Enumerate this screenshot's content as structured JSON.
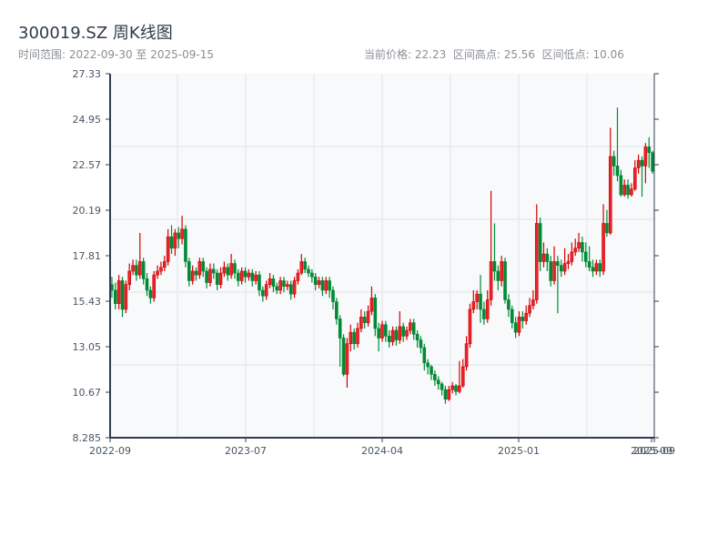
{
  "header": {
    "title": "300019.SZ 周K线图",
    "range_text": "时间范围: 2022-09-30 至 2025-09-15",
    "stats_text": "当前价格: 22.23  区间高点: 25.56  区间低点: 10.06"
  },
  "chart_data": {
    "type": "candlestick",
    "title": "300019.SZ 周K线图",
    "start_date": "2022-09-30",
    "end_date": "2025-09-15",
    "ylim": [
      8.285,
      27.33
    ],
    "y_ticks": [
      "27.33",
      "24.95",
      "22.57",
      "20.19",
      "17.81",
      "15.43",
      "13.05",
      "10.67",
      "8.285"
    ],
    "x_ticks": [
      "2022-09",
      "2023-07",
      "2024-04",
      "2025-01",
      "2025-09",
      "2025-09"
    ],
    "grid": true,
    "colors": {
      "up": "#d40000",
      "down": "#008a35"
    },
    "first_open": 16.3,
    "close": [
      16.0,
      15.3,
      16.5,
      15.0,
      16.3,
      17.0,
      17.3,
      16.8,
      17.5,
      16.6,
      16.0,
      15.6,
      16.8,
      17.0,
      17.2,
      17.5,
      18.8,
      18.2,
      19.0,
      18.7,
      19.2,
      17.5,
      16.5,
      17.0,
      16.8,
      17.5,
      17.0,
      16.4,
      17.1,
      16.9,
      16.3,
      16.9,
      17.2,
      16.8,
      17.4,
      16.9,
      16.5,
      17.0,
      16.7,
      16.9,
      16.5,
      16.8,
      16.0,
      15.7,
      16.3,
      16.6,
      16.2,
      16.0,
      16.5,
      16.2,
      16.3,
      15.8,
      16.5,
      16.9,
      17.5,
      17.1,
      16.9,
      16.7,
      16.3,
      16.5,
      16.0,
      16.5,
      16.0,
      15.4,
      14.5,
      13.5,
      11.6,
      13.2,
      13.8,
      13.2,
      14.0,
      14.6,
      14.3,
      14.9,
      15.6,
      14.0,
      13.5,
      14.2,
      13.6,
      13.3,
      13.9,
      13.4,
      14.1,
      13.6,
      13.9,
      14.3,
      13.7,
      13.4,
      13.0,
      12.2,
      12.0,
      11.6,
      11.3,
      11.1,
      10.8,
      10.3,
      10.8,
      11.0,
      10.7,
      11.0,
      12.0,
      13.2,
      15.0,
      15.4,
      15.8,
      15.0,
      14.5,
      15.5,
      17.5,
      17.0,
      16.5,
      17.5,
      15.5,
      15.0,
      14.3,
      13.8,
      14.6,
      14.4,
      14.8,
      15.2,
      15.5,
      19.5,
      17.5,
      17.9,
      17.5,
      16.5,
      17.5,
      17.3,
      17.0,
      17.4,
      17.5,
      18.0,
      18.2,
      18.5,
      18.0,
      17.5,
      17.2,
      17.0,
      17.4,
      17.0,
      19.5,
      19.0,
      23.0,
      22.5,
      22.0,
      21.0,
      21.5,
      21.0,
      21.3,
      22.4,
      22.8,
      22.5,
      23.5,
      23.2,
      22.23
    ],
    "high": [
      16.7,
      16.4,
      16.8,
      16.7,
      16.5,
      17.4,
      17.6,
      17.6,
      19.0,
      17.7,
      16.9,
      16.2,
      17.0,
      17.3,
      17.5,
      17.8,
      19.2,
      19.4,
      19.2,
      19.3,
      19.9,
      19.4,
      17.7,
      17.3,
      17.2,
      17.7,
      17.7,
      17.2,
      17.4,
      17.4,
      17.1,
      17.2,
      17.5,
      17.4,
      17.9,
      17.6,
      17.1,
      17.2,
      17.2,
      17.1,
      17.1,
      17.0,
      17.0,
      16.2,
      16.5,
      16.9,
      16.8,
      16.4,
      16.7,
      16.7,
      16.5,
      16.5,
      16.7,
      17.1,
      17.9,
      17.7,
      17.3,
      17.1,
      16.9,
      16.7,
      16.7,
      16.7,
      16.7,
      16.2,
      15.6,
      14.7,
      13.7,
      13.5,
      14.2,
      14.0,
      14.3,
      15.0,
      14.9,
      15.2,
      16.2,
      15.8,
      14.3,
      14.4,
      14.4,
      13.9,
      14.1,
      14.1,
      14.9,
      14.3,
      14.1,
      14.5,
      14.5,
      13.9,
      13.6,
      13.2,
      12.4,
      12.1,
      11.8,
      11.5,
      11.2,
      11.0,
      11.0,
      11.2,
      11.1,
      12.3,
      12.4,
      13.6,
      15.3,
      16.0,
      16.0,
      16.8,
      15.4,
      16.0,
      21.2,
      19.5,
      17.3,
      17.8,
      17.7,
      15.8,
      15.2,
      14.6,
      14.9,
      14.9,
      15.2,
      15.6,
      16.0,
      20.5,
      19.8,
      18.5,
      18.2,
      17.8,
      18.3,
      17.8,
      17.6,
      18.2,
      17.9,
      18.5,
      18.7,
      19.0,
      18.8,
      18.5,
      18.3,
      17.6,
      17.6,
      17.6,
      20.5,
      20.2,
      24.5,
      23.3,
      25.56,
      22.3,
      21.8,
      21.8,
      21.6,
      22.8,
      23.1,
      23.0,
      23.7,
      24.0,
      23.3
    ],
    "low": [
      15.6,
      15.0,
      15.0,
      14.6,
      14.8,
      16.0,
      16.8,
      16.5,
      16.6,
      16.3,
      15.7,
      15.3,
      15.4,
      16.6,
      16.8,
      17.0,
      17.3,
      17.9,
      17.8,
      18.2,
      18.4,
      17.2,
      16.2,
      16.3,
      16.5,
      16.6,
      16.7,
      16.1,
      16.2,
      16.6,
      16.0,
      16.1,
      16.7,
      16.5,
      16.6,
      16.6,
      16.2,
      16.3,
      16.4,
      16.5,
      16.2,
      16.3,
      15.7,
      15.4,
      15.5,
      16.1,
      15.9,
      15.8,
      15.8,
      15.9,
      16.0,
      15.5,
      15.6,
      16.3,
      16.8,
      16.9,
      16.7,
      16.4,
      16.0,
      16.1,
      15.7,
      15.8,
      15.6,
      15.0,
      14.2,
      12.0,
      11.5,
      10.9,
      12.8,
      12.9,
      13.0,
      13.8,
      14.0,
      14.1,
      14.7,
      13.6,
      12.8,
      13.3,
      13.3,
      13.0,
      13.1,
      13.1,
      13.2,
      13.3,
      13.4,
      13.7,
      13.4,
      13.0,
      12.7,
      11.8,
      11.6,
      11.3,
      11.0,
      10.8,
      10.5,
      10.06,
      10.2,
      10.6,
      10.5,
      10.6,
      10.9,
      11.8,
      13.0,
      14.8,
      15.0,
      14.3,
      14.2,
      14.3,
      15.2,
      16.5,
      16.0,
      16.2,
      15.3,
      14.6,
      14.0,
      13.5,
      13.6,
      14.0,
      14.2,
      14.6,
      15.0,
      15.3,
      17.0,
      17.2,
      17.0,
      16.2,
      16.3,
      14.8,
      16.7,
      16.8,
      17.1,
      17.3,
      17.8,
      18.0,
      17.5,
      17.2,
      17.0,
      16.7,
      16.8,
      16.7,
      16.8,
      18.8,
      18.9,
      22.0,
      21.7,
      20.9,
      20.9,
      20.8,
      20.9,
      21.2,
      22.1,
      20.9,
      21.6,
      22.4,
      22.1
    ]
  }
}
